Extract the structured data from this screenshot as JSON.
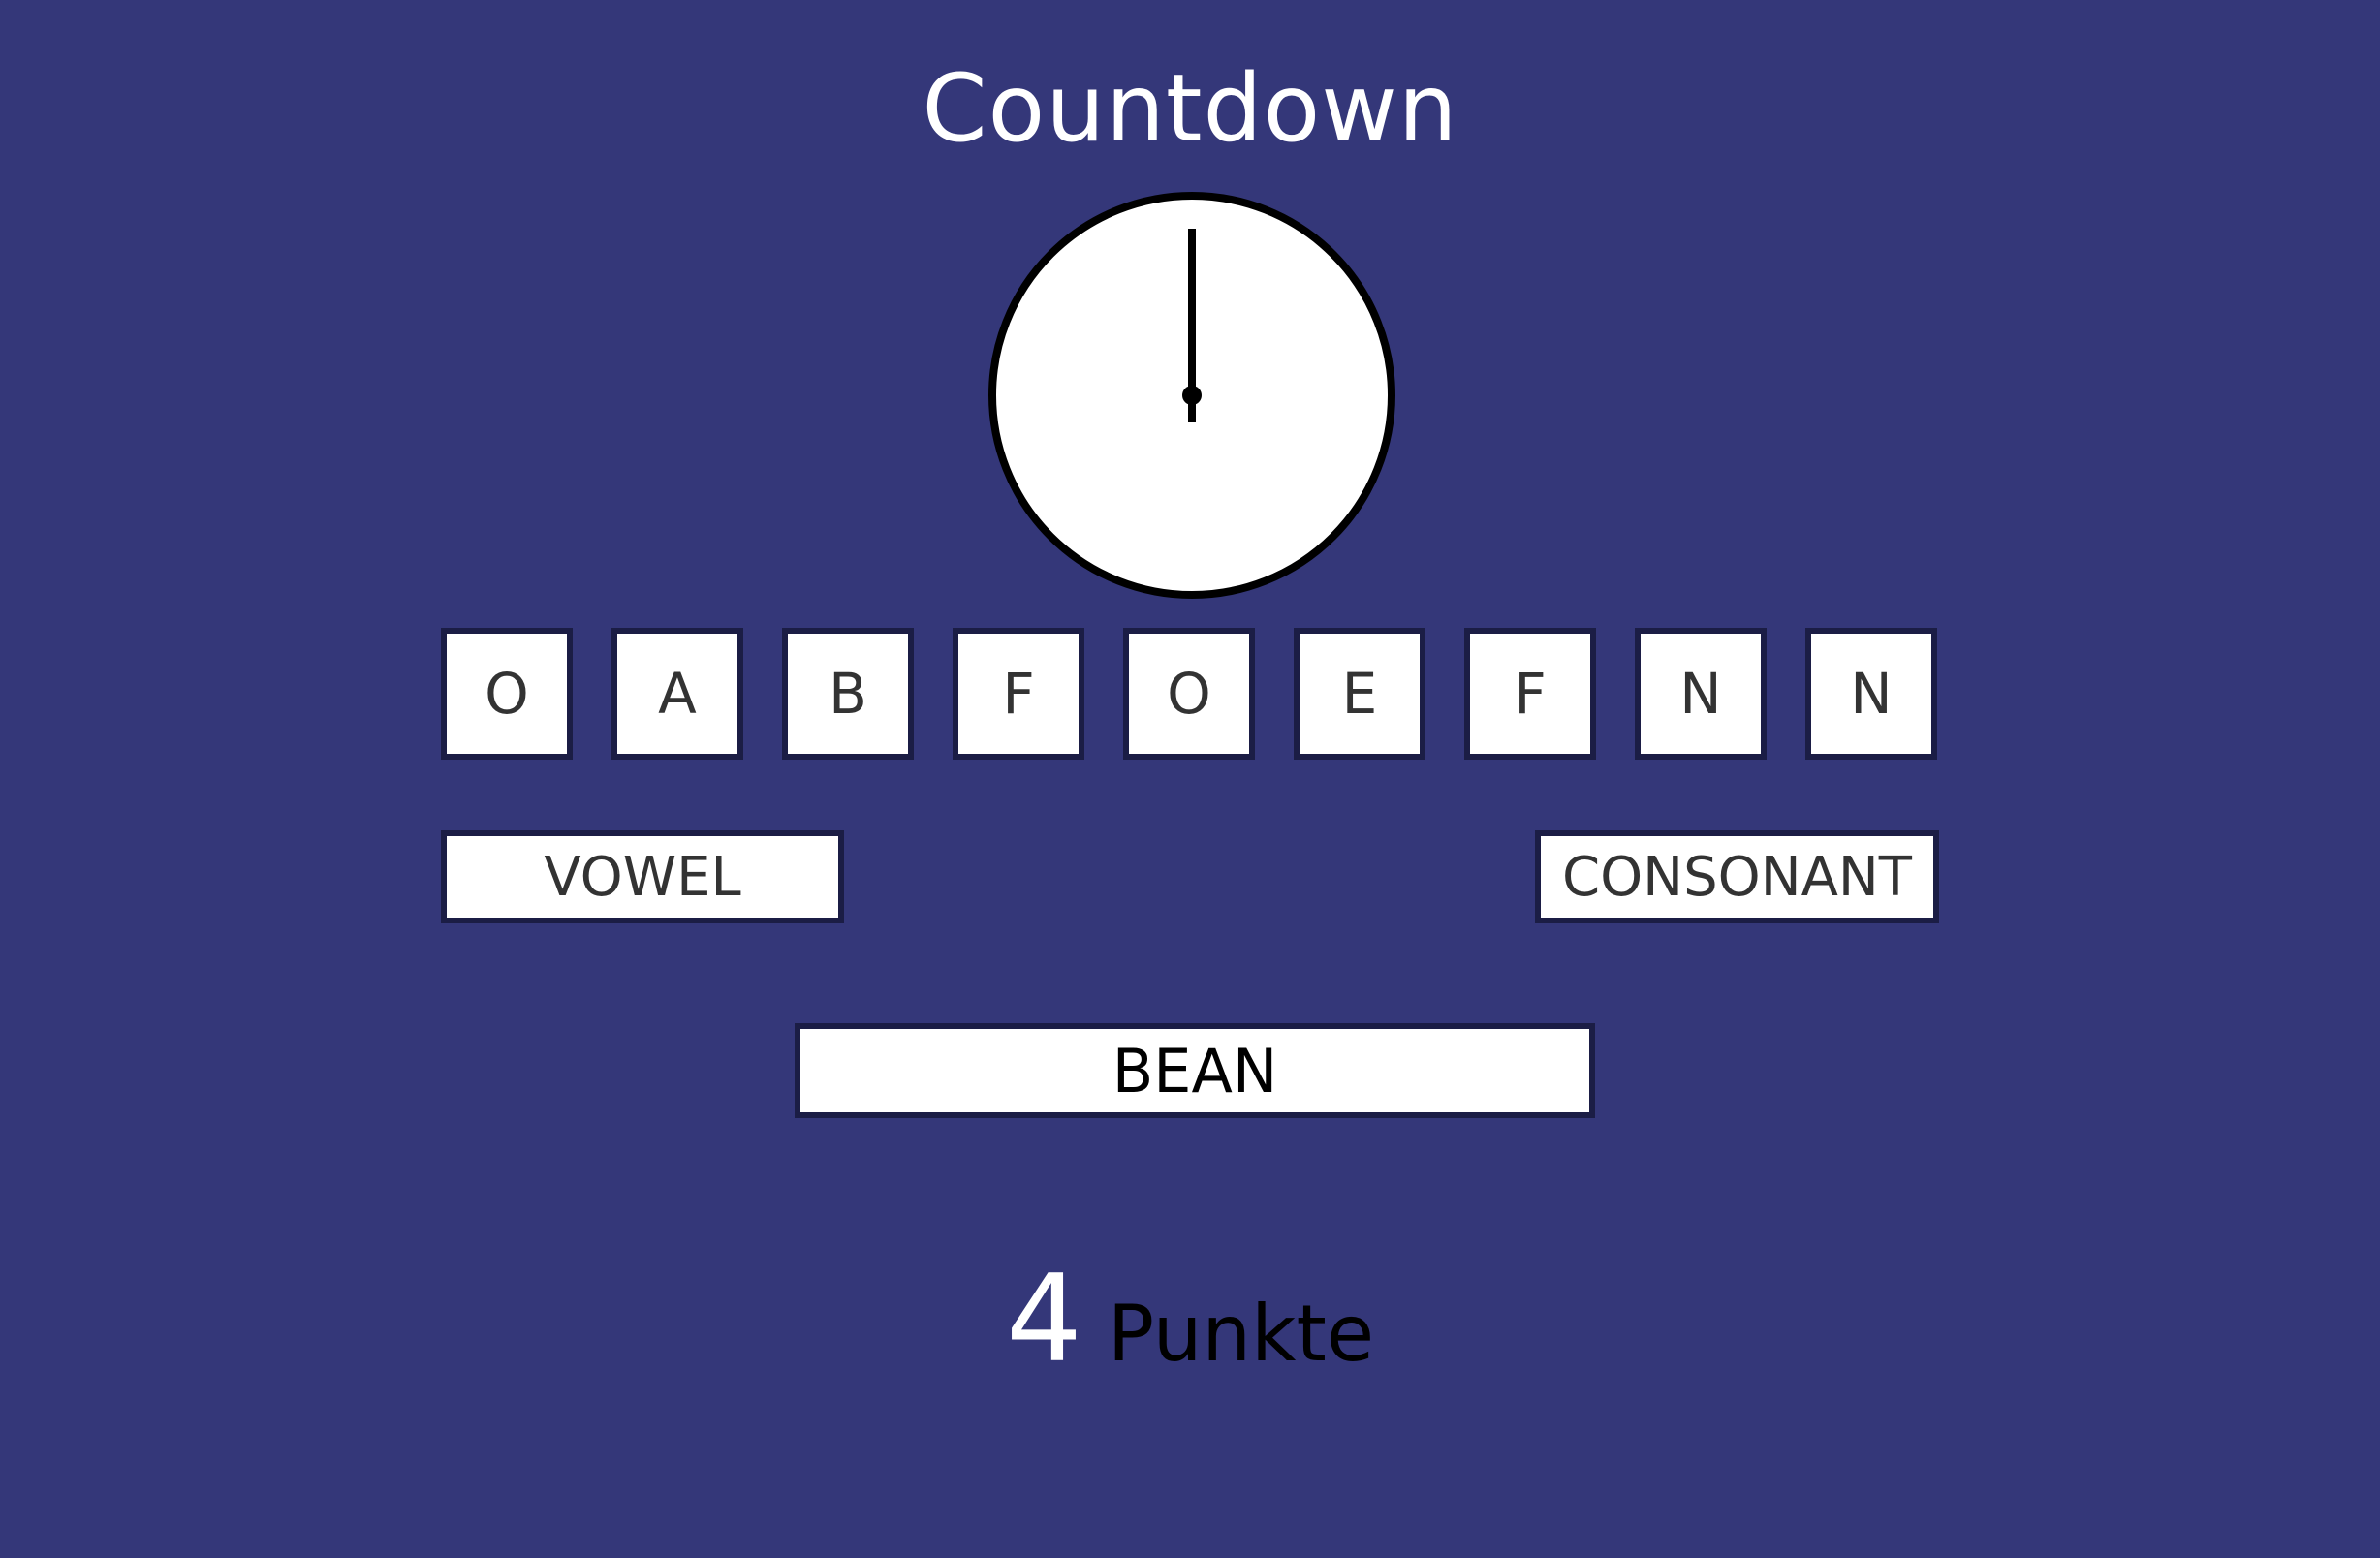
{
  "title": "Countdown",
  "clock": {
    "progress": 0,
    "face_color": "#ffffff",
    "stroke_color": "#000000"
  },
  "tiles": [
    "O",
    "A",
    "B",
    "F",
    "O",
    "E",
    "F",
    "N",
    "N"
  ],
  "buttons": {
    "vowel": "VOWEL",
    "consonant": "CONSONANT"
  },
  "word": "BEAN",
  "score": {
    "value": "4",
    "label": "Punkte"
  },
  "colors": {
    "background": "#343779",
    "tile_border": "#1b1d45"
  }
}
